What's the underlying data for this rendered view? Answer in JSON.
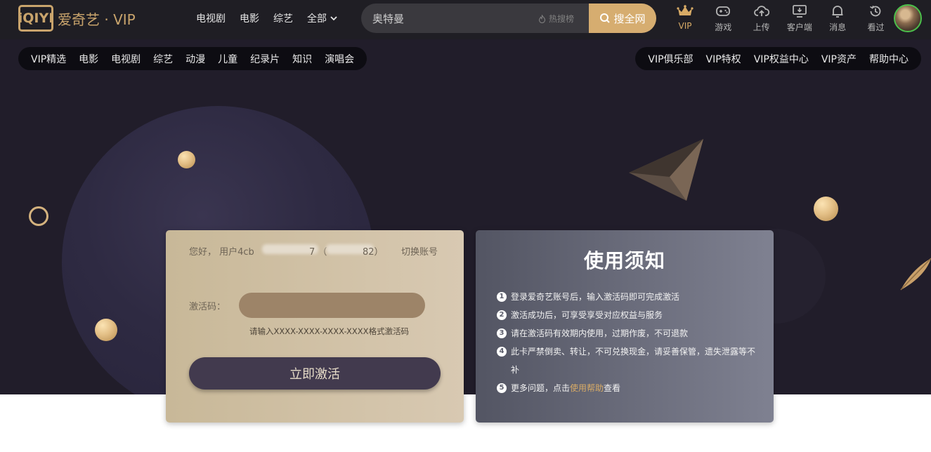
{
  "header": {
    "logo_mark": "iQIYI",
    "logo_text": "爱奇艺 · VIP",
    "nav": [
      "电视剧",
      "电影",
      "综艺"
    ],
    "nav_all": "全部",
    "search": {
      "value": "奥特曼",
      "hot_label": "热搜榜",
      "button_label": "搜全网"
    },
    "icons": [
      {
        "label": "VIP",
        "icon": "crown-icon"
      },
      {
        "label": "游戏",
        "icon": "gamepad-icon"
      },
      {
        "label": "上传",
        "icon": "upload-cloud-icon"
      },
      {
        "label": "客户端",
        "icon": "desktop-download-icon"
      },
      {
        "label": "消息",
        "icon": "bell-icon"
      },
      {
        "label": "看过",
        "icon": "history-icon"
      }
    ]
  },
  "subnav": {
    "left": [
      "VIP精选",
      "电影",
      "电视剧",
      "综艺",
      "动漫",
      "儿童",
      "纪录片",
      "知识",
      "演唱会"
    ],
    "right": [
      "VIP俱乐部",
      "VIP特权",
      "VIP权益中心",
      "VIP资产",
      "帮助中心"
    ]
  },
  "activation": {
    "greeting": "您好， 用户4cb",
    "greeting_tail": "7 （",
    "greeting_end": "82）",
    "switch_account": "切换账号",
    "code_label": "激活码：",
    "code_value": "",
    "hint": "请输入XXXX-XXXX-XXXX-XXXX格式激活码",
    "button": "立即激活"
  },
  "notice": {
    "title": "使用须知",
    "rules": [
      {
        "num": "1",
        "text": "登录爱奇艺账号后，输入激活码即可完成激活"
      },
      {
        "num": "2",
        "text": "激活成功后，可享受享受对应权益与服务"
      },
      {
        "num": "3",
        "text": "请在激活码有效期内使用，过期作废，不可退款"
      },
      {
        "num": "4",
        "text": "此卡严禁倒卖、转让，不可兑换现金，请妥善保管，遗失泄露等不补"
      },
      {
        "num": "5",
        "text_before": "更多问题，点击",
        "link": "使用帮助",
        "text_after": "查看"
      }
    ]
  },
  "colors": {
    "gold": "#d6ad70",
    "header_bg": "#1f1e24",
    "hero_bg": "#211d2a",
    "activate_button": "#423a4e"
  }
}
